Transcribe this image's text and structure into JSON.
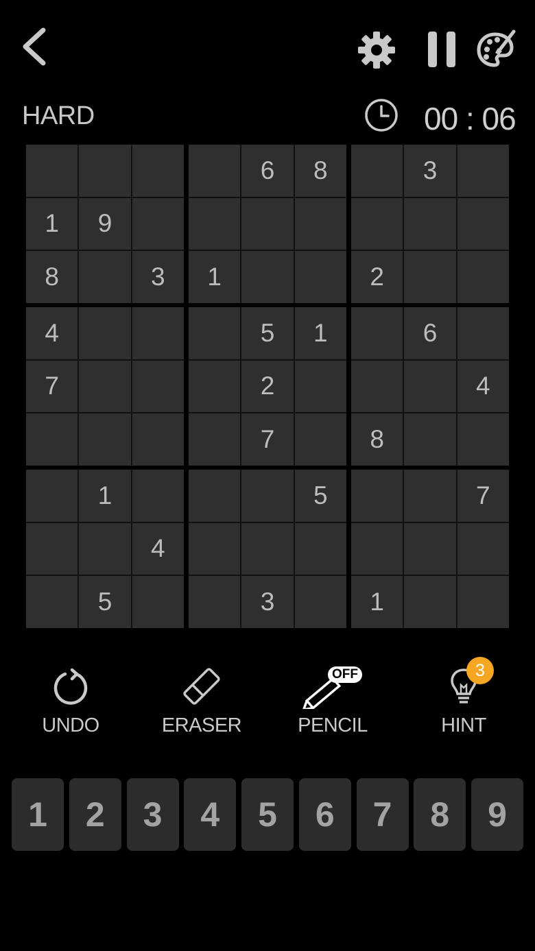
{
  "header": {
    "difficulty": "HARD",
    "timer": "00 : 06"
  },
  "icons": {
    "back": "chevron-left-icon",
    "settings": "gear-icon",
    "pause": "pause-icon",
    "theme": "palette-icon",
    "clock": "clock-icon"
  },
  "board": {
    "cells": [
      [
        "",
        "",
        "",
        "",
        "6",
        "8",
        "",
        "3",
        ""
      ],
      [
        "1",
        "9",
        "",
        "",
        "",
        "",
        "",
        "",
        ""
      ],
      [
        "8",
        "",
        "3",
        "1",
        "",
        "",
        "2",
        "",
        ""
      ],
      [
        "4",
        "",
        "",
        "",
        "5",
        "1",
        "",
        "6",
        ""
      ],
      [
        "7",
        "",
        "",
        "",
        "2",
        "",
        "",
        "",
        "4"
      ],
      [
        "",
        "",
        "",
        "",
        "7",
        "",
        "8",
        "",
        ""
      ],
      [
        "",
        "1",
        "",
        "",
        "",
        "5",
        "",
        "",
        "7"
      ],
      [
        "",
        "",
        "4",
        "",
        "",
        "",
        "",
        "",
        ""
      ],
      [
        "",
        "5",
        "",
        "",
        "3",
        "",
        "1",
        "",
        ""
      ]
    ]
  },
  "tools": {
    "undo": "UNDO",
    "eraser": "ERASER",
    "pencil": "PENCIL",
    "pencil_state": "OFF",
    "hint": "HINT",
    "hint_count": "3"
  },
  "numpad": [
    "1",
    "2",
    "3",
    "4",
    "5",
    "6",
    "7",
    "8",
    "9"
  ],
  "colors": {
    "background": "#000000",
    "cell": "#2f2f2f",
    "digit": "#bdbdbd",
    "badge": "#f5a623"
  }
}
